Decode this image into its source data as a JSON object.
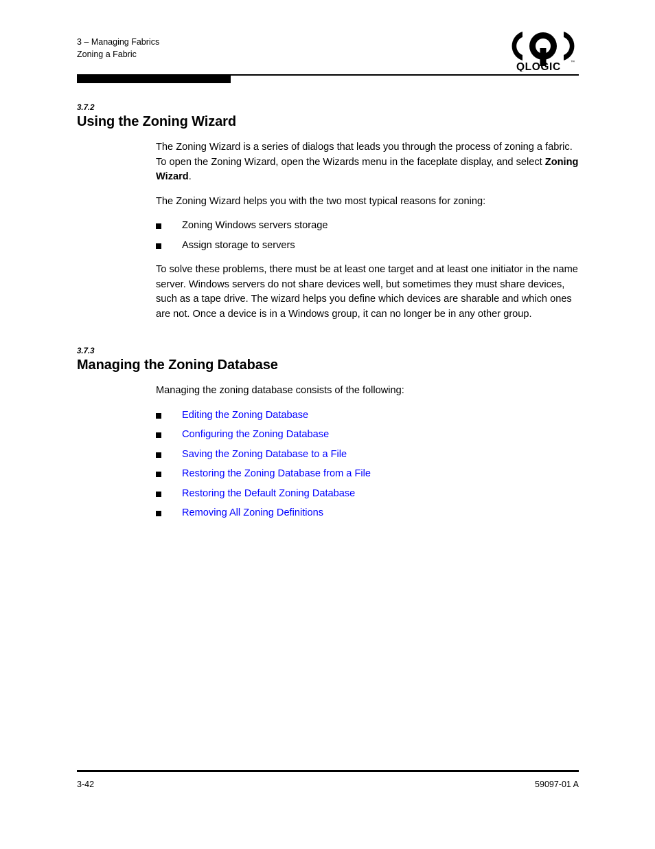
{
  "header": {
    "line1": "3 – Managing Fabrics",
    "line2": "Zoning a Fabric",
    "logo_wordmark": "QLOGIC",
    "logo_tm": "™"
  },
  "sections": [
    {
      "number": "3.7.2",
      "title": "Using the Zoning Wizard",
      "para1_a": "The Zoning Wizard is a series of dialogs that leads you through the process of zoning a fabric. To open the Zoning Wizard, open the Wizards menu in the faceplate display, and select ",
      "para1_bold": "Zoning Wizard",
      "para1_b": ".",
      "para2": "The Zoning Wizard helps you with the two most typical reasons for zoning:",
      "bullets": [
        "Zoning Windows servers storage",
        "Assign storage to servers"
      ],
      "para3": "To solve these problems, there must be at least one target and at least one initiator in the name server. Windows servers do not share devices well, but sometimes they must share devices, such as a tape drive. The wizard helps you define which devices are sharable and which ones are not. Once a device is in a Windows group, it can no longer be in any other group."
    },
    {
      "number": "3.7.3",
      "title": "Managing the Zoning Database",
      "para1": "Managing the zoning database consists of the following:",
      "links": [
        "Editing the Zoning Database",
        "Configuring the Zoning Database",
        "Saving the Zoning Database to a File",
        "Restoring the Zoning Database from a File",
        "Restoring the Default Zoning Database",
        "Removing All Zoning Definitions"
      ]
    }
  ],
  "footer": {
    "page_number": "3-42",
    "document_number": "59097-01 A"
  },
  "colors": {
    "link": "#0000FF",
    "text": "#000000",
    "background": "#FFFFFF"
  }
}
